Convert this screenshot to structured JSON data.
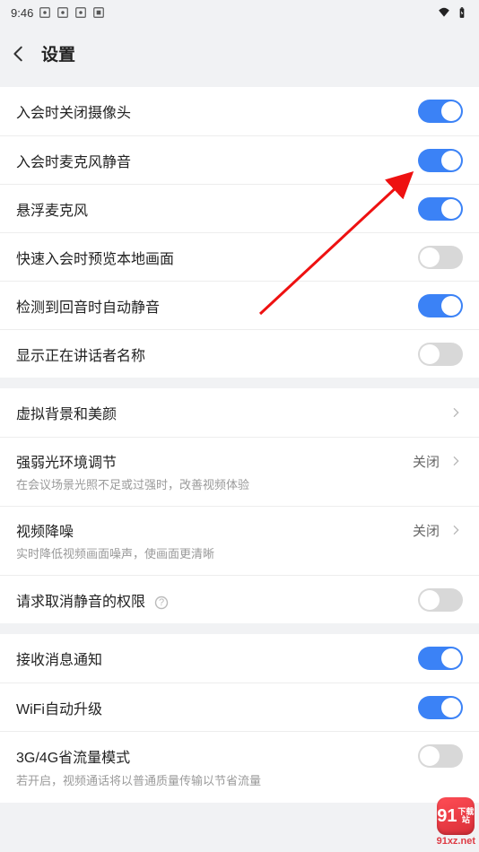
{
  "status": {
    "time": "9:46"
  },
  "header": {
    "title": "设置"
  },
  "group1": {
    "camera_off": {
      "label": "入会时关闭摄像头",
      "on": true
    },
    "mic_mute": {
      "label": "入会时麦克风静音",
      "on": true
    },
    "float_mic": {
      "label": "悬浮麦克风",
      "on": true
    },
    "preview": {
      "label": "快速入会时预览本地画面",
      "on": false
    },
    "echo_mute": {
      "label": "检测到回音时自动静音",
      "on": true
    },
    "speaker_name": {
      "label": "显示正在讲话者名称",
      "on": false
    }
  },
  "group2": {
    "beauty": {
      "label": "虚拟背景和美颜"
    },
    "light": {
      "label": "强弱光环境调节",
      "value": "关闭",
      "desc": "在会议场景光照不足或过强时，改善视频体验"
    },
    "denoise": {
      "label": "视频降噪",
      "value": "关闭",
      "desc": "实时降低视频画面噪声，使画面更清晰"
    },
    "unmute_perm": {
      "label": "请求取消静音的权限",
      "on": false
    }
  },
  "group3": {
    "notify": {
      "label": "接收消息通知",
      "on": true
    },
    "wifi_up": {
      "label": "WiFi自动升级",
      "on": true
    },
    "cellular": {
      "label": "3G/4G省流量模式",
      "on": false,
      "desc": "若开启，视频通话将以普通质量传输以节省流量"
    }
  },
  "watermark": {
    "text": "91",
    "sub": "下载站",
    "url": "91xz.net"
  }
}
